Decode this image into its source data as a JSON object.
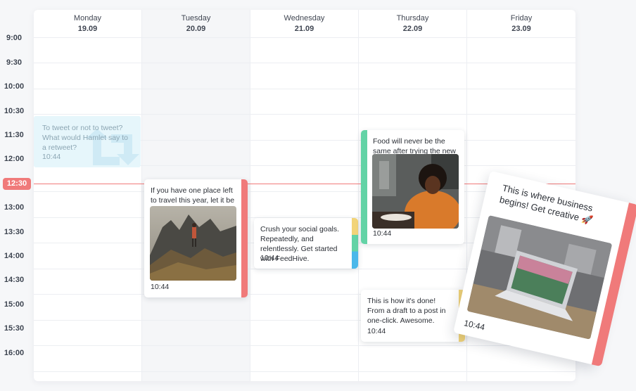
{
  "times": [
    "9:00",
    "9:30",
    "10:00",
    "10:30",
    "11:30",
    "12:00",
    "12:30",
    "13:00",
    "13:30",
    "14:00",
    "14:30",
    "15:00",
    "15:30",
    "16:00"
  ],
  "current_time": "12:30",
  "days": [
    {
      "name": "Monday",
      "date": "19.09"
    },
    {
      "name": "Tuesday",
      "date": "20.09"
    },
    {
      "name": "Wednesday",
      "date": "21.09"
    },
    {
      "name": "Thursday",
      "date": "22.09"
    },
    {
      "name": "Friday",
      "date": "23.09"
    }
  ],
  "posts": {
    "monday_draft": {
      "text": "To tweet or not to tweet? What would Hamlet say to a retweet?",
      "time": "10:44"
    },
    "tuesday_post": {
      "text": "If you have one place left to travel this year, let it be sw...",
      "time": "10:44",
      "image": "mountain-hiker-photo"
    },
    "wednesday_post": {
      "text": "Crush your social goals. Repeatedly, and relentlessly. Get started with FeedHive.",
      "time": "10:44"
    },
    "thursday_post": {
      "text": "Food will never be the same after trying the new prem...",
      "time": "10:44",
      "image": "woman-eating-photo"
    },
    "thursday_post_2": {
      "text": "This is how it's done! From a draft to a post in one-click. Awesome.",
      "time": "10:44"
    },
    "dragged_post": {
      "text": "This is where business begins! Get creative 🚀",
      "time": "10:44",
      "image": "laptop-desk-photo"
    }
  },
  "colors": {
    "accent_red": "#f07a7a",
    "accent_green": "#63d3a6",
    "accent_yellow": "#f2d479",
    "accent_blue": "#4bb8ea",
    "draft_bg": "#e6f6fb"
  }
}
